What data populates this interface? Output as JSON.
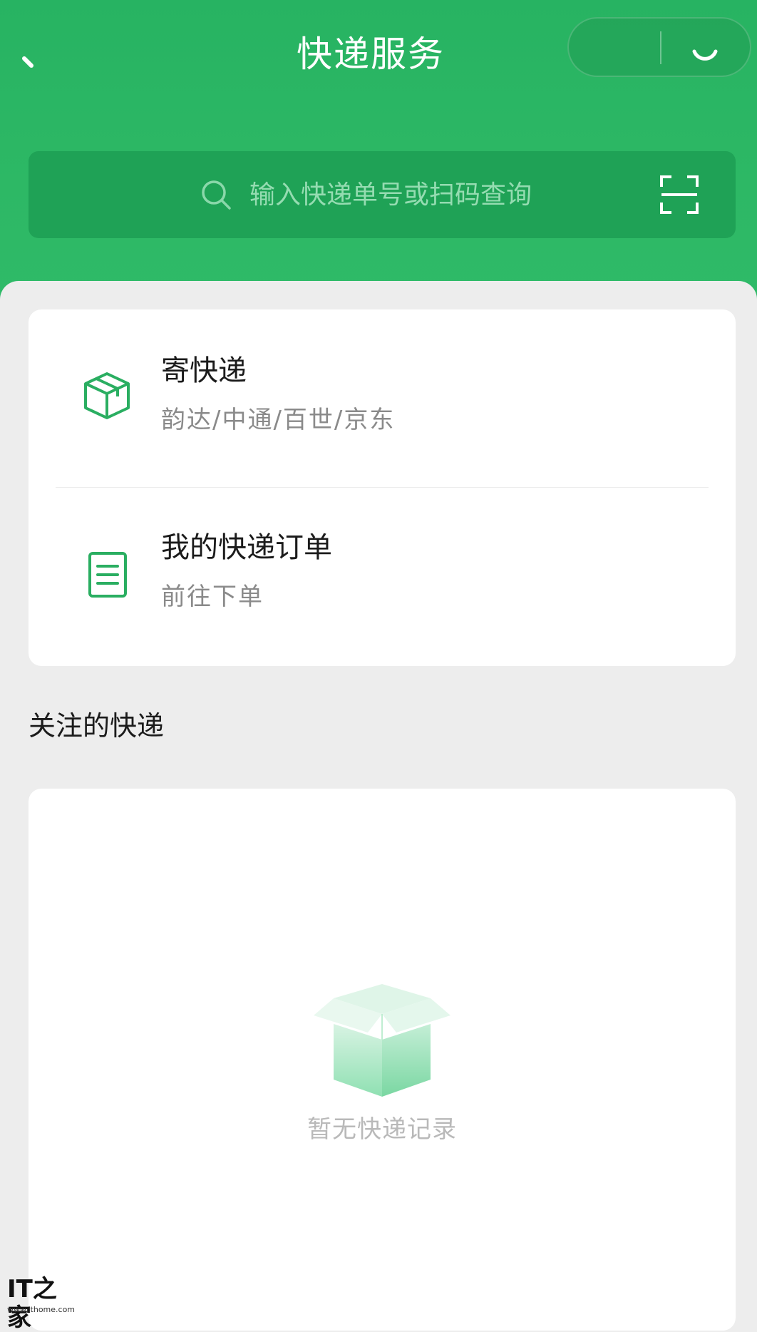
{
  "header": {
    "title": "快递服务"
  },
  "search": {
    "placeholder": "输入快递单号或扫码查询"
  },
  "services": [
    {
      "title": "寄快递",
      "subtitle": "韵达/中通/百世/京东",
      "icon": "package-box-icon"
    },
    {
      "title": "我的快递订单",
      "subtitle": "前往下单",
      "icon": "order-document-icon"
    }
  ],
  "followed": {
    "section_title": "关注的快递",
    "empty_text": "暂无快递记录"
  },
  "watermark": {
    "logo": "IT之家",
    "url": "www.ithome.com"
  },
  "colors": {
    "brand_green": "#2db865",
    "search_bg": "#1fa256",
    "accent_icon": "#2aae61"
  }
}
